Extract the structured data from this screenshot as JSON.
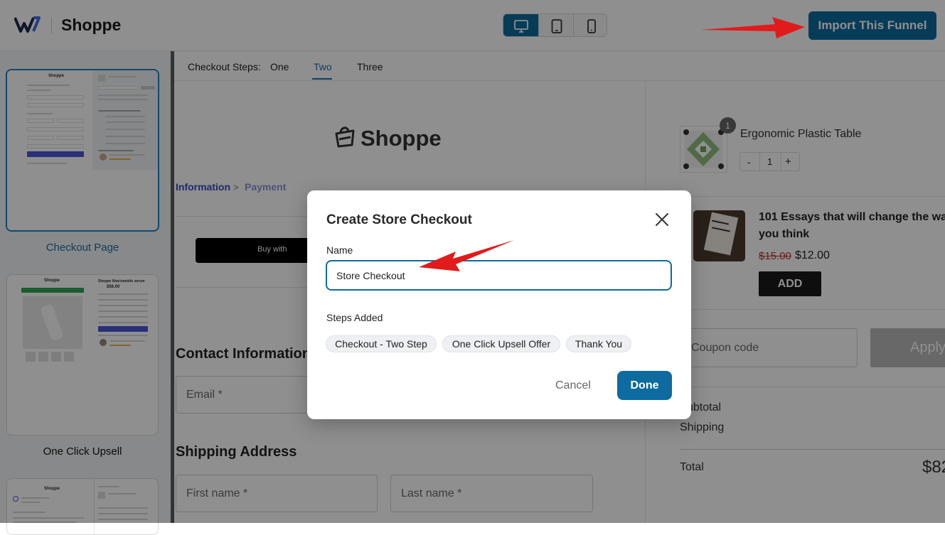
{
  "topbar": {
    "brand": "Shoppe",
    "import_button": "Import This Funnel",
    "devices": [
      "desktop-icon",
      "tablet-icon",
      "mobile-icon"
    ],
    "accent": "#0e6b9f"
  },
  "sidebar": {
    "items": [
      {
        "label": "Checkout Page"
      },
      {
        "label": "One Click Upsell"
      }
    ],
    "thumb_brand": "Shoppe",
    "thumb_upsell_title": "Shoppe Niacinamide serum",
    "thumb_upsell_price": "$56.00"
  },
  "steps": {
    "label": "Checkout Steps:",
    "tabs": [
      "One",
      "Two",
      "Three"
    ],
    "active": "Two"
  },
  "preview": {
    "logo_text": "Shoppe",
    "breadcrumb": {
      "current": "Information",
      "sep": ">",
      "next": "Payment"
    },
    "gpay_text": "Buy with",
    "contact_heading": "Contact Information",
    "email_placeholder": "Email *",
    "shipping_heading": "Shipping Address",
    "first_name_placeholder": "First name *",
    "last_name_placeholder": "Last name *",
    "cart": {
      "item_name": "Ergonomic Plastic Table",
      "item_qty_badge": "1",
      "qty_minus": "-",
      "qty_value": "1",
      "qty_plus": "+",
      "upsell_title_line1": "101 Essays that will change the wa",
      "upsell_title_line2": "you think",
      "old_price": "$15.00",
      "new_price": "$12.00",
      "add_button": "ADD",
      "coupon_placeholder": "Coupon code",
      "apply_button": "Apply",
      "subtotal": "ubtotal",
      "shipping": "Shipping",
      "total": "Total",
      "total_value": "$82"
    }
  },
  "modal": {
    "title": "Create Store Checkout",
    "name_label": "Name",
    "name_value": "Store Checkout",
    "steps_label": "Steps Added",
    "steps": [
      "Checkout - Two Step",
      "One Click Upsell Offer",
      "Thank You"
    ],
    "cancel": "Cancel",
    "done": "Done"
  }
}
